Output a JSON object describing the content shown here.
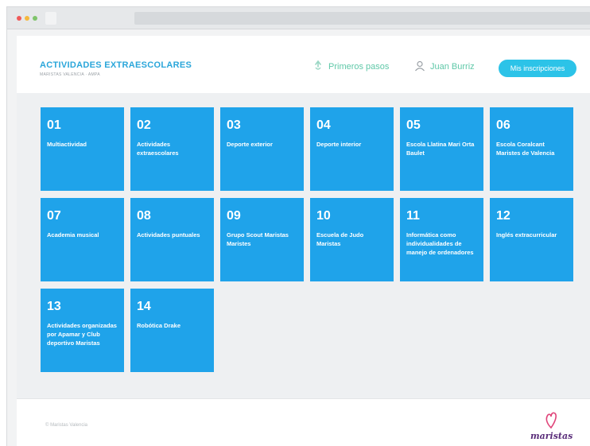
{
  "header": {
    "title": "ACTIVIDADES EXTRAESCOLARES",
    "subtitle": "MARISTAS VALENCIA · AMPA",
    "first_steps_label": "Primeros pasos",
    "first_steps_icon": "hand-pointer-icon",
    "user_name": "Juan Burriz",
    "user_icon": "user-icon",
    "profile_button_label": "Mis inscripciones"
  },
  "activities": [
    {
      "number": "01",
      "label": "Multiactividad"
    },
    {
      "number": "02",
      "label": "Actividades extraescolares"
    },
    {
      "number": "03",
      "label": "Deporte exterior"
    },
    {
      "number": "04",
      "label": "Deporte interior"
    },
    {
      "number": "05",
      "label": "Escola Llatina Mari Orta Baulet"
    },
    {
      "number": "06",
      "label": "Escola Coralcant Maristes de Valencia"
    },
    {
      "number": "07",
      "label": "Academia musical"
    },
    {
      "number": "08",
      "label": "Actividades puntuales"
    },
    {
      "number": "09",
      "label": "Grupo Scout Maristas Maristes"
    },
    {
      "number": "10",
      "label": "Escuela de Judo Maristas"
    },
    {
      "number": "11",
      "label": "Informática como individualidades de manejo de ordenadores"
    },
    {
      "number": "12",
      "label": "Inglés extracurricular"
    },
    {
      "number": "13",
      "label": "Actividades organizadas por Apamar y Club deportivo Maristas"
    },
    {
      "number": "14",
      "label": "Robótica Drake"
    }
  ],
  "footer": {
    "text": "© Maristas Valencia",
    "brand_name": "maristas"
  },
  "colors": {
    "tile": "#1fa3ea",
    "title": "#2aa6da",
    "nav": "#5fc8a8",
    "button": "#2cc3e8",
    "brand": "#5a2d7a"
  }
}
